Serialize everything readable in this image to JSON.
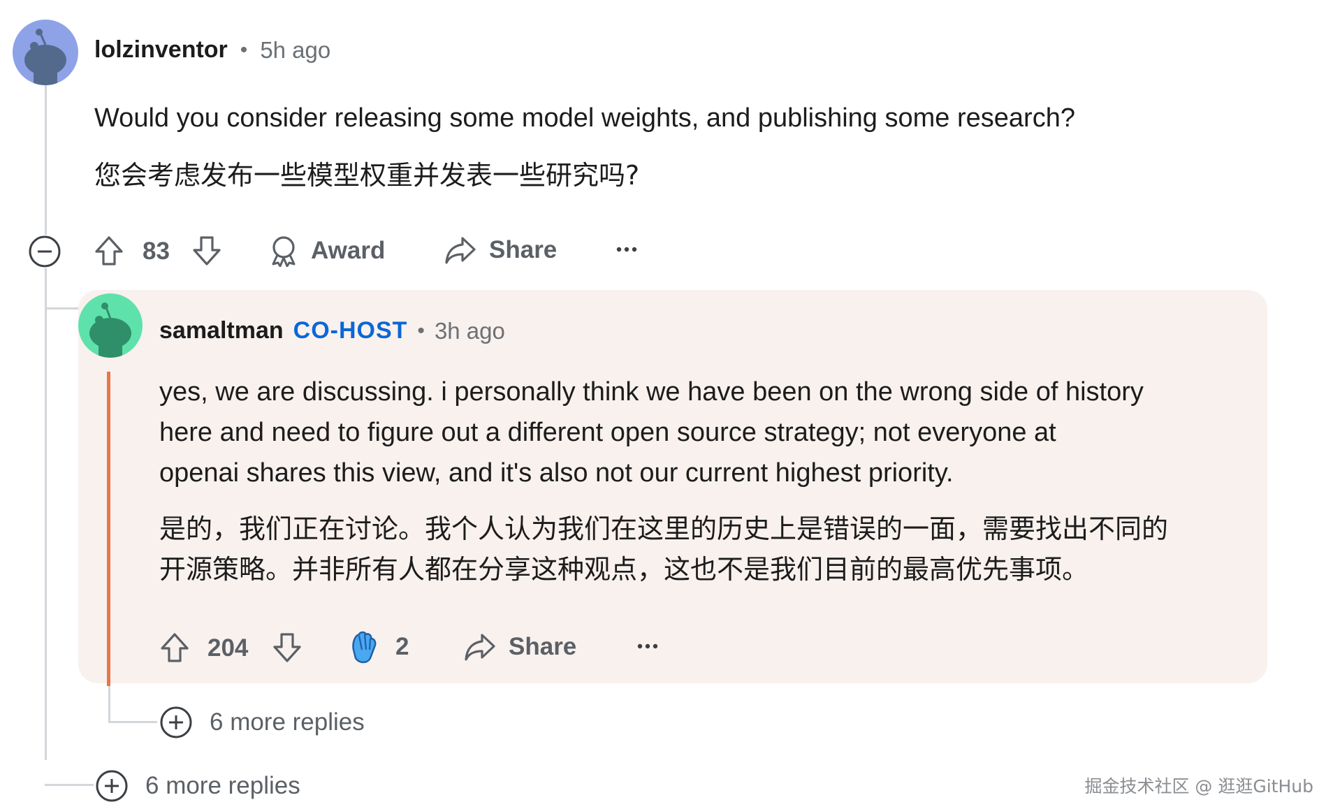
{
  "comment": {
    "username": "lolzinventor",
    "time": "5h ago",
    "text_en": "Would you consider releasing some model weights, and publishing some research?",
    "text_zh": "您会考虑发布一些模型权重并发表一些研究吗?",
    "votes": "83",
    "award_label": "Award",
    "share_label": "Share",
    "more_replies": "6 more replies"
  },
  "reply": {
    "username": "samaltman",
    "flair": "CO-HOST",
    "time": "3h ago",
    "text_en_lines": [
      "yes, we are discussing. i personally think we have been on the wrong side of history",
      "here and need to figure out a different open source strategy; not everyone at",
      "openai shares this view, and it's also not our current highest priority."
    ],
    "text_zh_lines": [
      "是的，我们正在讨论。我个人认为我们在这里的历史上是错误的一面，需要找出不同的",
      "开源策略。并非所有人都在分享这种观点，这也不是我们目前的最高优先事项。"
    ],
    "votes": "204",
    "award_count": "2",
    "share_label": "Share",
    "more_replies": "6 more replies"
  },
  "watermark": "掘金技术社区 @ 逛逛GitHub",
  "colors": {
    "accent": "#e8764a",
    "flair": "#0a67d6",
    "reply_bg": "#f9f1ee",
    "avatar1": "#8ea2e8",
    "avatar2": "#5fe1ab"
  }
}
